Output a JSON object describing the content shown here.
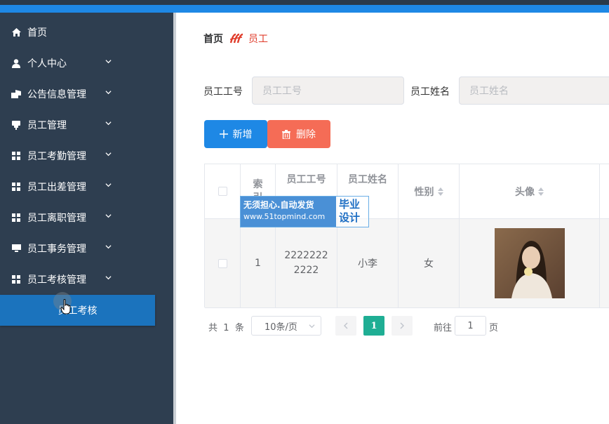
{
  "sidebar": {
    "items": [
      {
        "label": "首页",
        "icon": "home-icon"
      },
      {
        "label": "个人中心",
        "icon": "user-icon"
      },
      {
        "label": "公告信息管理",
        "icon": "notice-icon"
      },
      {
        "label": "员工管理",
        "icon": "staff-icon"
      },
      {
        "label": "员工考勤管理",
        "icon": "grid-icon"
      },
      {
        "label": "员工出差管理",
        "icon": "grid-icon"
      },
      {
        "label": "员工离职管理",
        "icon": "grid-icon"
      },
      {
        "label": "员工事务管理",
        "icon": "monitor-icon"
      },
      {
        "label": "员工考核管理",
        "icon": "grid-icon"
      }
    ],
    "active_sub": "员工考核"
  },
  "breadcrumb": {
    "home": "首页",
    "separator_icon": "logo-separator-icon",
    "current": "员工"
  },
  "search": {
    "no_label": "员工工号",
    "no_placeholder": "员工工号",
    "name_label": "员工姓名",
    "name_placeholder": "员工姓名"
  },
  "actions": {
    "add": "新增",
    "delete": "删除",
    "add_color": "#1e88e5",
    "delete_color": "#f56c56"
  },
  "table": {
    "columns": [
      "索引",
      "员工工号",
      "员工姓名",
      "性别",
      "头像"
    ],
    "rows": [
      {
        "index": "1",
        "no": "22222222222",
        "name": "小李",
        "gender": "女",
        "avatar": "photo"
      }
    ]
  },
  "pagination": {
    "total_prefix": "共",
    "total": "1",
    "total_suffix": "条",
    "page_size": "10条/页",
    "current_page": "1",
    "goto_prefix": "前往",
    "goto_value": "1",
    "goto_suffix": "页",
    "active_color": "#1fae94"
  },
  "watermark": {
    "line1": "无须担心.自动发货",
    "line2": "www.51topmind.com",
    "side": "毕业设计"
  }
}
